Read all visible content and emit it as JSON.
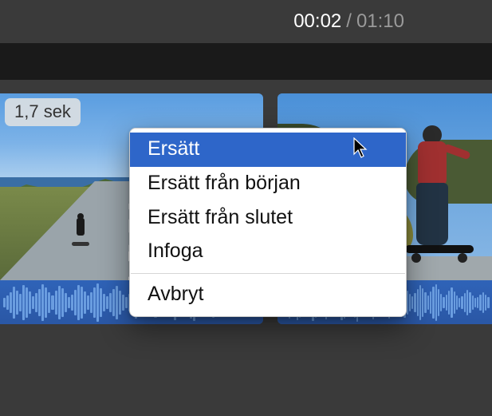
{
  "time": {
    "current": "00:02",
    "separator": "/",
    "total": "01:10"
  },
  "clip": {
    "duration_badge": "1,7 sek"
  },
  "context_menu": {
    "items": [
      {
        "label": "Ersätt",
        "selected": true
      },
      {
        "label": "Ersätt från början",
        "selected": false
      },
      {
        "label": "Ersätt från slutet",
        "selected": false
      },
      {
        "label": "Infoga",
        "selected": false
      }
    ],
    "cancel_label": "Avbryt"
  }
}
